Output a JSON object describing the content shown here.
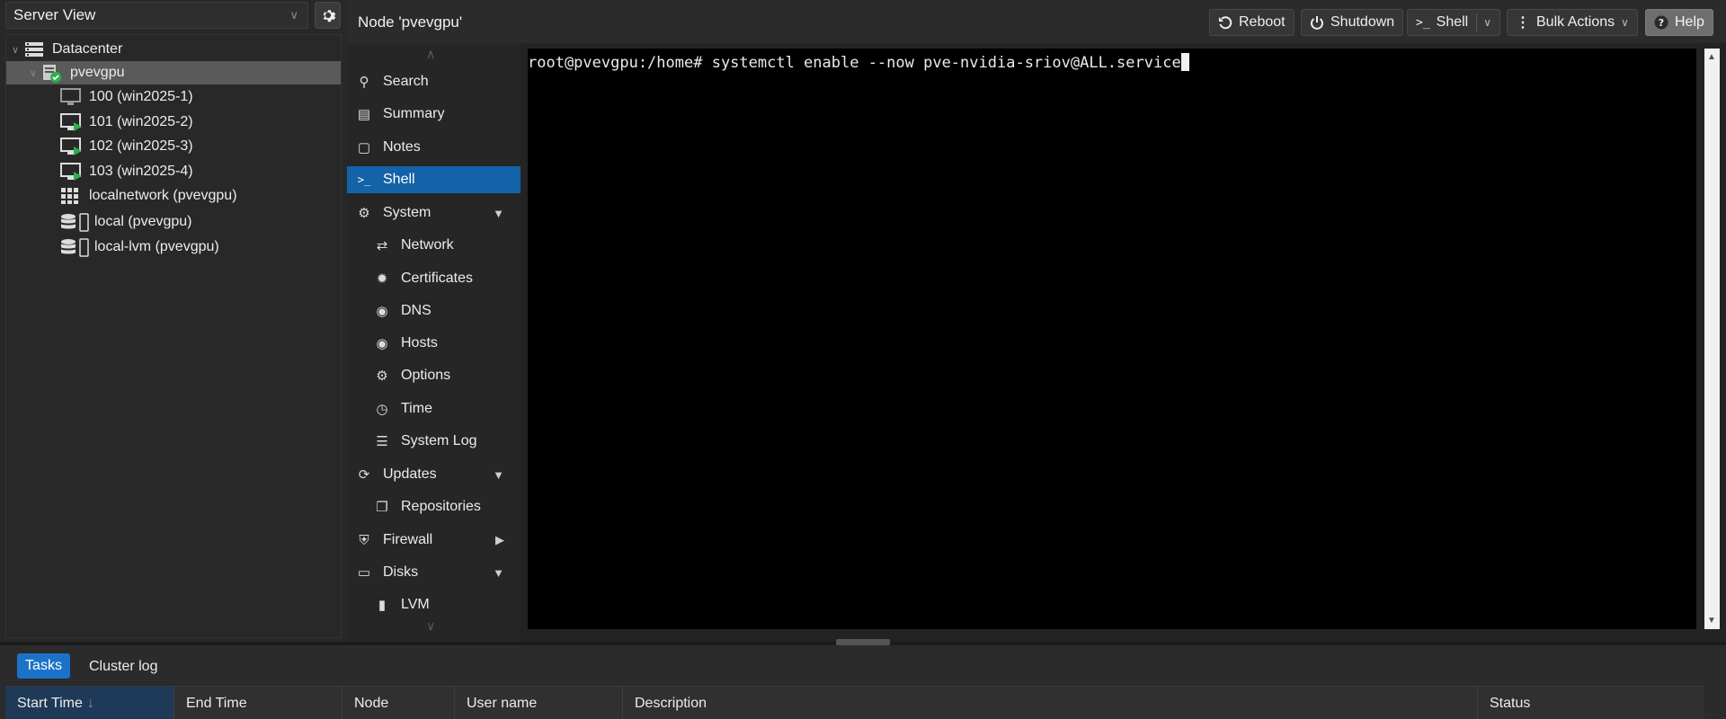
{
  "view_selector": {
    "value": "Server View"
  },
  "tree": {
    "datacenter": "Datacenter",
    "node": "pvevgpu",
    "items": [
      {
        "label": "100 (win2025-1)",
        "icon": "vm-stopped-icon"
      },
      {
        "label": "101 (win2025-2)",
        "icon": "vm-running-icon"
      },
      {
        "label": "102 (win2025-3)",
        "icon": "vm-running-icon"
      },
      {
        "label": "103 (win2025-4)",
        "icon": "vm-running-icon"
      },
      {
        "label": "localnetwork (pvevgpu)",
        "icon": "network-grid-icon"
      },
      {
        "label": "local (pvevgpu)",
        "icon": "storage-icon"
      },
      {
        "label": "local-lvm (pvevgpu)",
        "icon": "storage-icon"
      }
    ]
  },
  "header": {
    "title": "Node 'pvevgpu'",
    "buttons": {
      "reboot": "Reboot",
      "shutdown": "Shutdown",
      "shell": "Shell",
      "bulk": "Bulk Actions",
      "help": "Help"
    }
  },
  "nav": {
    "items": [
      {
        "label": "Search",
        "icon": "search-icon"
      },
      {
        "label": "Summary",
        "icon": "summary-icon"
      },
      {
        "label": "Notes",
        "icon": "notes-icon"
      },
      {
        "label": "Shell",
        "icon": "terminal-icon",
        "active": true
      },
      {
        "label": "System",
        "icon": "cogs-icon",
        "expand": "down"
      },
      {
        "label": "Network",
        "icon": "exchange-icon",
        "sub": true
      },
      {
        "label": "Certificates",
        "icon": "certificate-icon",
        "sub": true
      },
      {
        "label": "DNS",
        "icon": "globe-icon",
        "sub": true
      },
      {
        "label": "Hosts",
        "icon": "globe-icon",
        "sub": true
      },
      {
        "label": "Options",
        "icon": "gear-icon",
        "sub": true
      },
      {
        "label": "Time",
        "icon": "clock-icon",
        "sub": true
      },
      {
        "label": "System Log",
        "icon": "list-icon",
        "sub": true
      },
      {
        "label": "Updates",
        "icon": "refresh-icon",
        "expand": "down"
      },
      {
        "label": "Repositories",
        "icon": "repositories-icon",
        "sub": true
      },
      {
        "label": "Firewall",
        "icon": "shield-icon",
        "expand": "right"
      },
      {
        "label": "Disks",
        "icon": "hdd-icon",
        "expand": "down"
      },
      {
        "label": "LVM",
        "icon": "lvm-icon",
        "sub": true
      }
    ]
  },
  "terminal": {
    "prompt": "root@pvevgpu:/home# ",
    "command": "systemctl enable --now pve-nvidia-sriov@ALL.service"
  },
  "tasks": {
    "tabs": [
      "Tasks",
      "Cluster log"
    ],
    "columns": [
      "Start Time",
      "End Time",
      "Node",
      "User name",
      "Description",
      "Status"
    ],
    "sort_indicator": "↓"
  },
  "colors": {
    "accent": "#1463a8",
    "tab_active": "#1a73c8",
    "running": "#2bb24c"
  }
}
